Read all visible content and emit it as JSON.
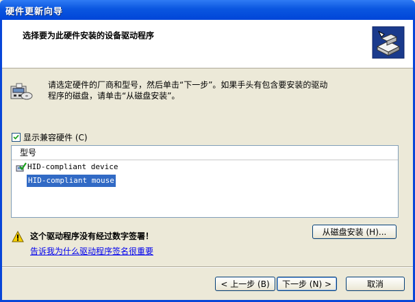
{
  "window": {
    "title": "硬件更新向导"
  },
  "header": {
    "heading": "选择要为此硬件安装的设备驱动程序",
    "icon": "hardware-install-icon"
  },
  "intro": {
    "icon": "device-disk-icon",
    "line1": "请选定硬件的厂商和型号，然后单击“下一步”。如果手头有包含要安装的驱动",
    "line2": "程序的磁盘，请单击“从磁盘安装”。"
  },
  "compatible": {
    "label": "显示兼容硬件 (C)",
    "checked": true
  },
  "list": {
    "header": "型号",
    "items": [
      {
        "label": "HID-compliant device",
        "icon": "signed-driver-icon",
        "selected": false
      },
      {
        "label": "HID-compliant mouse",
        "icon": "",
        "selected": true
      }
    ]
  },
  "warning": {
    "icon": "warning-icon",
    "title": "这个驱动程序没有经过数字签署！",
    "link": "告诉我为什么驱动程序签名很重要"
  },
  "buttons": {
    "have_disk": "从磁盘安装 (H)...",
    "back": "< 上一步 (B)",
    "next": "下一步 (N) >",
    "cancel": "取消"
  }
}
